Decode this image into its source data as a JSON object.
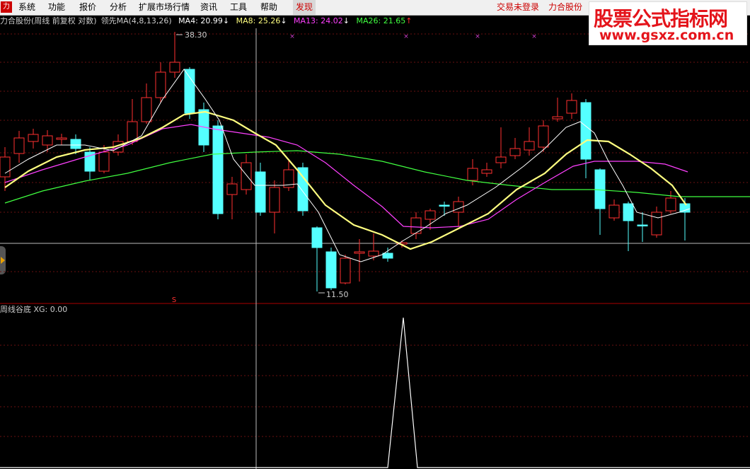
{
  "menu": {
    "items": [
      "系统",
      "功能",
      "报价",
      "分析",
      "扩展市场行情",
      "资讯",
      "工具",
      "帮助",
      "发现"
    ],
    "login_status": "交易未登录",
    "brand": "力合股份"
  },
  "watermark": {
    "title": "股票公式指标网",
    "url": "www.gsxz.com.cn"
  },
  "main_panel": {
    "stock_label": "力合股份(周线 前复权 对数)",
    "indicator_label": "领先MA(4,8,13,26)",
    "ma4": "MA4: 20.99",
    "ma8": "MA8: 25.26",
    "ma13": "MA13: 24.02",
    "ma26": "MA26: 21.65",
    "high_label": "38.30",
    "low_label": "11.50",
    "signal_mark": "S",
    "colors": {
      "ma4": "#ffffff",
      "ma8": "#ffff80",
      "ma13": "#ff40ff",
      "ma26": "#40ff40",
      "up": "#ff3030",
      "down": "#54ffff"
    }
  },
  "sub_panel": {
    "title": "周线谷底",
    "xg_label": "XG: 0.00"
  }
}
